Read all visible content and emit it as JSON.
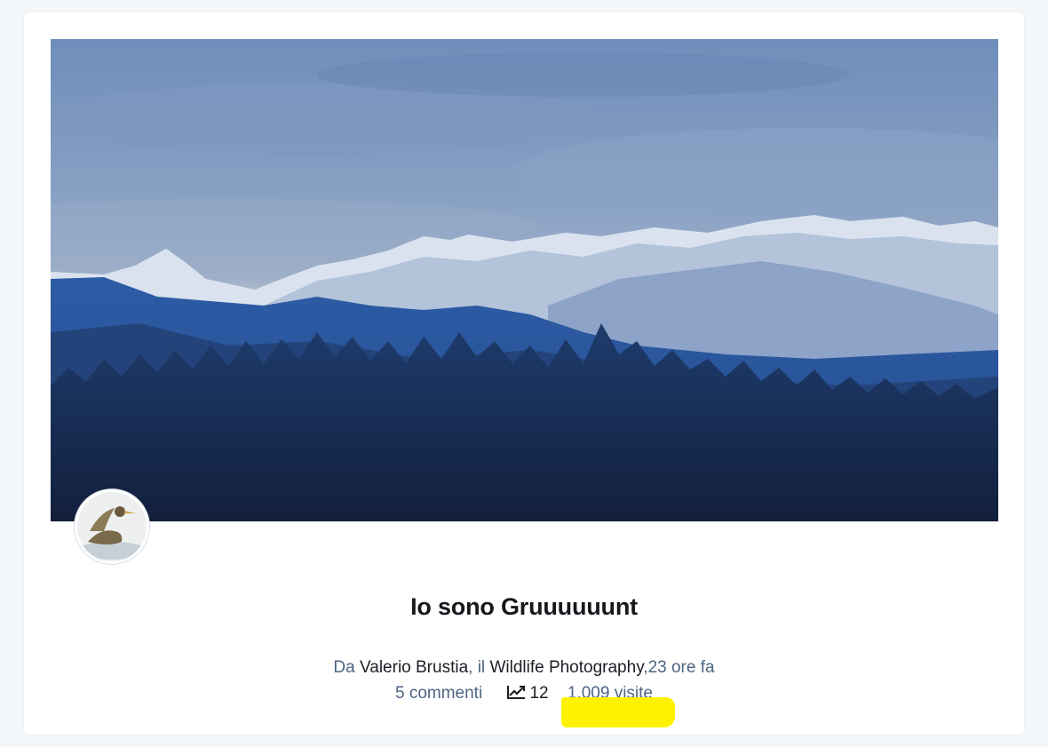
{
  "post": {
    "title": "Io sono Gruuuuuunt",
    "by_prefix": "Da ",
    "author": "Valerio Brustia",
    "in_prefix": ", il ",
    "category": "Wildlife Photography",
    "time": ",23 ore fa",
    "comments": "5 commenti",
    "likes": "12",
    "views": "1.009 visite"
  },
  "image": {
    "subject": "snowy mountain range at dusk above dark forest"
  },
  "icons": {
    "trend": "trending-up-icon"
  },
  "colors": {
    "highlight": "#fff200",
    "meta_text": "#4d6482",
    "title_text": "#15181c"
  }
}
